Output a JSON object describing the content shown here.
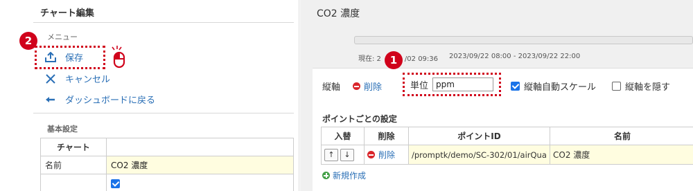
{
  "left_panel": {
    "title": "チャート編集",
    "menu_label": "メニュー",
    "menu": {
      "save": "保存",
      "cancel": "キャンセル",
      "back": "ダッシュボードに戻る"
    },
    "basic_settings_label": "基本設定",
    "table": {
      "header": "チャート",
      "rows": [
        {
          "label": "名前",
          "value": "CO2 濃度"
        },
        {
          "label": "",
          "value": "checked"
        }
      ]
    }
  },
  "right_panel": {
    "title": "CO2 濃度",
    "now_label": "現在: 2",
    "now_value": "/02 09:36",
    "time_range": "2023/09/22 08:00 - 2023/09/22 22:00",
    "axis": {
      "label": "縦軸",
      "delete": "削除",
      "unit_label": "単位",
      "unit_value": "ppm",
      "auto_scale": "縦軸自動スケール",
      "hide_axis": "縦軸を隠す"
    },
    "points_label": "ポイントごとの設定",
    "points_table": {
      "headers": [
        "入替",
        "削除",
        "ポイントID",
        "名前"
      ],
      "rows": [
        {
          "delete": "削除",
          "point_id": "/promptk/demo/SC-302/01/airQua",
          "name": "CO2 濃度"
        }
      ]
    },
    "new_create": "新規作成"
  },
  "annotations": {
    "badge_1": "1",
    "badge_2": "2"
  },
  "colors": {
    "accent": "#2a6fb6",
    "highlight": "#d0021b",
    "yellow_cell": "#fffde0"
  }
}
